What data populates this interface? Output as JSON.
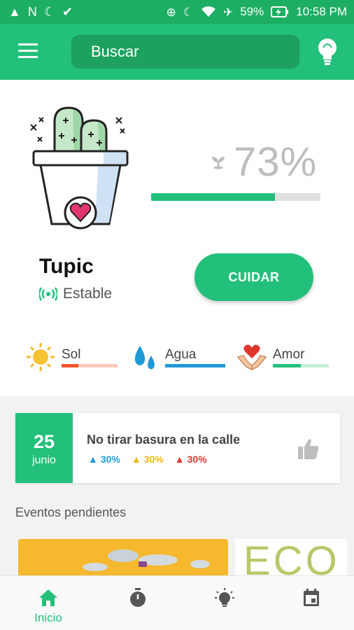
{
  "status_bar": {
    "battery": "59%",
    "time": "10:58 PM",
    "icons_left": [
      "warning-icon",
      "n-icon",
      "moon-icon",
      "v-icon"
    ],
    "icons_right": [
      "clock-icon",
      "moon-icon",
      "wifi-icon",
      "airplane-icon",
      "battery-charging-icon"
    ]
  },
  "app_bar": {
    "search_placeholder": "Buscar",
    "color": "#22c07a"
  },
  "plant": {
    "name": "Tupic",
    "state": "Estable",
    "health_percent": "73%",
    "health_value": 73,
    "action_label": "CUIDAR"
  },
  "stats": [
    {
      "label": "Sol",
      "icon": "sun-icon",
      "fill": 0.3,
      "color": "#f0562a",
      "track": "#f9c9b8"
    },
    {
      "label": "Agua",
      "icon": "water-drops-icon",
      "fill": 1.0,
      "color": "#1f9ad6",
      "track": "#b9e1f4"
    },
    {
      "label": "Amor",
      "icon": "love-hands-icon",
      "fill": 0.5,
      "color": "#22c07a",
      "track": "#c6eed9"
    }
  ],
  "event": {
    "day": "25",
    "month": "junio",
    "title": "No tirar basura en la calle",
    "metrics": [
      {
        "value": "30%",
        "color": "#1f9ad6"
      },
      {
        "value": "30%",
        "color": "#f2b611"
      },
      {
        "value": "30%",
        "color": "#e0352b"
      }
    ]
  },
  "pending": {
    "title": "Eventos pendientes",
    "card_b_text": "ECO"
  },
  "bottom_nav": {
    "items": [
      {
        "label": "Inicio",
        "icon": "home-icon",
        "active": true
      },
      {
        "label": "",
        "icon": "stopwatch-icon",
        "active": false
      },
      {
        "label": "",
        "icon": "lightbulb-icon",
        "active": false
      },
      {
        "label": "",
        "icon": "calendar-icon",
        "active": false
      }
    ]
  }
}
